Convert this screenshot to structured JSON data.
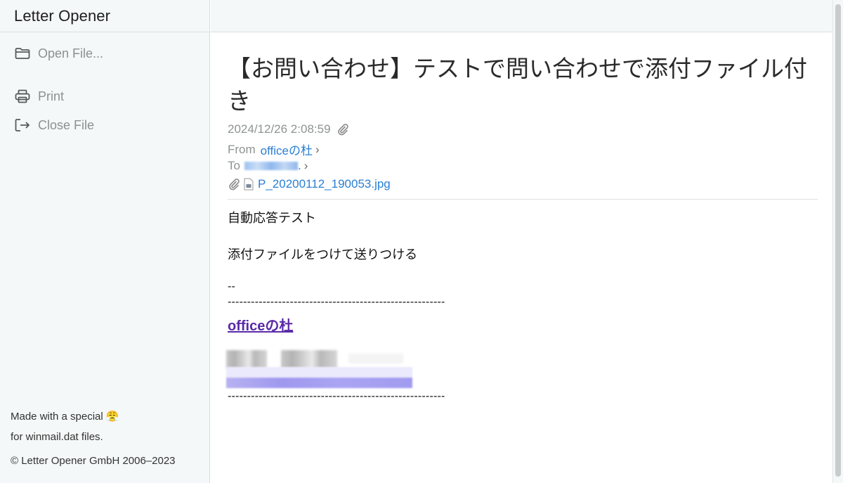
{
  "app": {
    "title": "Letter Opener"
  },
  "sidebar": {
    "items": [
      {
        "label": "Open File...",
        "icon": "folder-icon"
      },
      {
        "label": "Print",
        "icon": "printer-icon"
      },
      {
        "label": "Close File",
        "icon": "logout-icon"
      }
    ],
    "footer": {
      "line1": "Made with a special 😤",
      "line2": "for winmail.dat files.",
      "copyright": "© Letter Opener GmbH 2006–2023"
    }
  },
  "email": {
    "subject": "【お問い合わせ】テストで問い合わせで添付ファイル付き",
    "date": "2024/12/26 2:08:59",
    "from_label": "From",
    "from_name": "officeの杜",
    "to_label": "To",
    "to_suffix": ".",
    "attachment": "P_20200112_190053.jpg",
    "body_line1": "自動応答テスト",
    "body_line2": "添付ファイルをつけて送りつける",
    "sig_marker": "--",
    "dash_line": "--------------------------------------------------------",
    "signature_link": "officeの杜",
    "chevron": "›"
  },
  "colors": {
    "accent": "#2a7fd4",
    "visited_link": "#5a2aa8",
    "sidebar_bg": "#f5f8f8"
  }
}
